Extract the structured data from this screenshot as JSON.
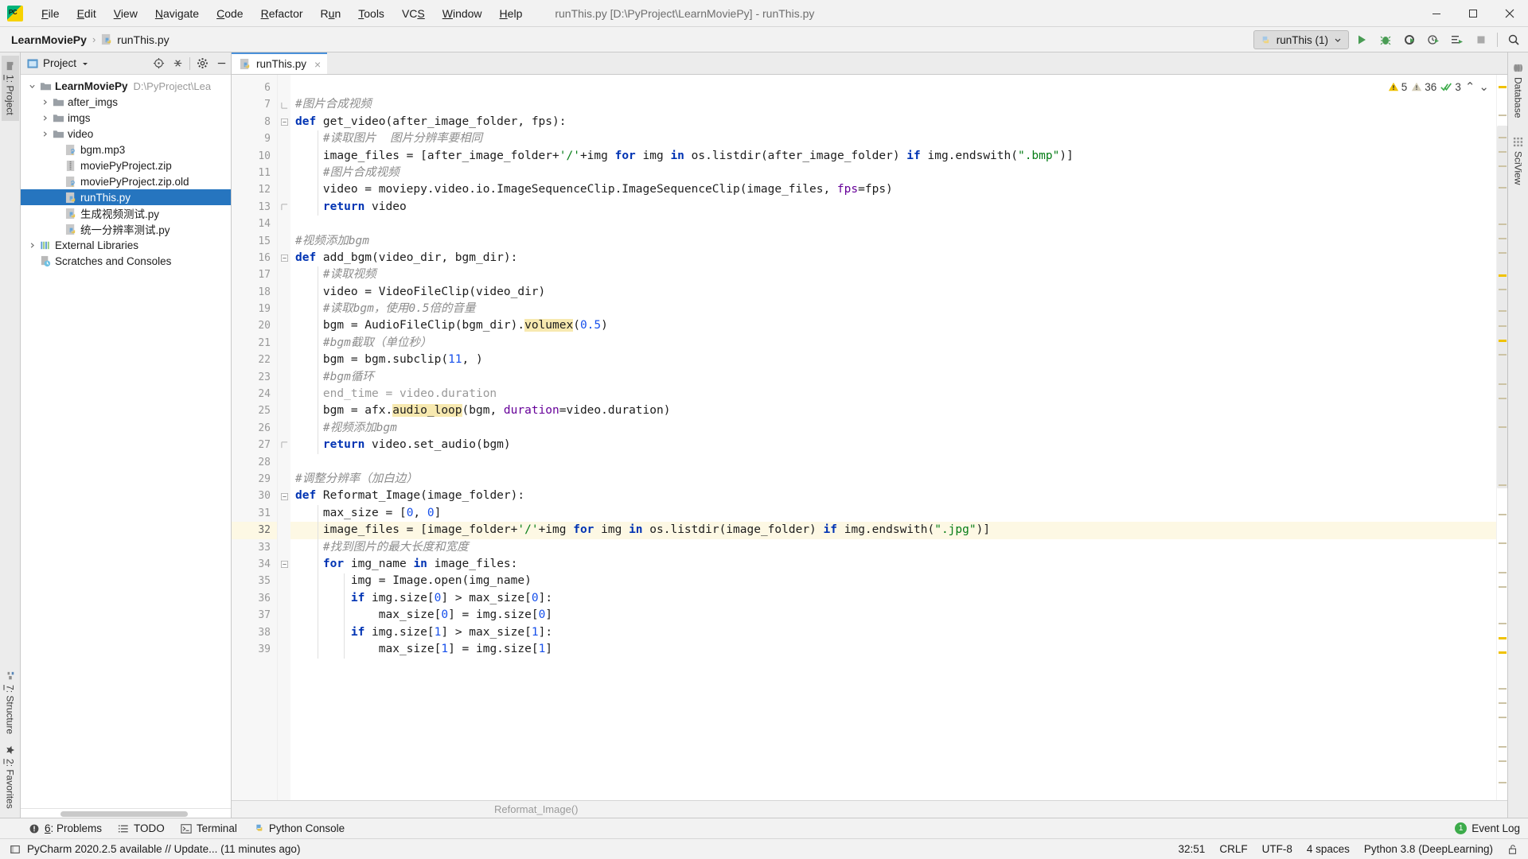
{
  "window": {
    "title": "runThis.py [D:\\PyProject\\LearnMoviePy] - runThis.py",
    "logo": "pycharm-logo"
  },
  "menubar": {
    "items": [
      {
        "pre": "",
        "mn": "F",
        "post": "ile"
      },
      {
        "pre": "",
        "mn": "E",
        "post": "dit"
      },
      {
        "pre": "",
        "mn": "V",
        "post": "iew"
      },
      {
        "pre": "",
        "mn": "N",
        "post": "avigate"
      },
      {
        "pre": "",
        "mn": "C",
        "post": "ode"
      },
      {
        "pre": "",
        "mn": "R",
        "post": "efactor"
      },
      {
        "pre": "R",
        "mn": "u",
        "post": "n"
      },
      {
        "pre": "",
        "mn": "T",
        "post": "ools"
      },
      {
        "pre": "VC",
        "mn": "S",
        "post": ""
      },
      {
        "pre": "",
        "mn": "W",
        "post": "indow"
      },
      {
        "pre": "",
        "mn": "H",
        "post": "elp"
      }
    ]
  },
  "navbar": {
    "project_name": "LearnMoviePy",
    "separator": "›",
    "file_name": "runThis.py",
    "run_config": "runThis (1)",
    "buttons": [
      "run-button",
      "debug-button",
      "run-coverage-button",
      "profile-button",
      "run-with-console-button",
      "stop-button",
      "search-everywhere-button"
    ]
  },
  "left_strip": {
    "top": {
      "num": "1",
      "label": ": Project",
      "icon": "folder-icon"
    },
    "bottom": [
      {
        "num": "7",
        "label": ": Structure",
        "icon": "structure-icon"
      },
      {
        "num": "2",
        "label": ": Favorites",
        "icon": "star-icon"
      }
    ]
  },
  "project_panel": {
    "title": "Project",
    "header_buttons": [
      "locate-icon",
      "collapse-all-icon",
      "settings-gear-icon",
      "hide-icon"
    ],
    "tree": [
      {
        "indent": 0,
        "arrow": "down",
        "icon": "folder-icon",
        "label": "LearnMoviePy",
        "bold": true,
        "path": "D:\\PyProject\\Lea",
        "selected": false
      },
      {
        "indent": 1,
        "arrow": "right",
        "icon": "folder-icon",
        "label": "after_imgs",
        "bold": false,
        "path": "",
        "selected": false
      },
      {
        "indent": 1,
        "arrow": "right",
        "icon": "folder-icon",
        "label": "imgs",
        "bold": false,
        "path": "",
        "selected": false
      },
      {
        "indent": 1,
        "arrow": "right",
        "icon": "folder-icon",
        "label": "video",
        "bold": false,
        "path": "",
        "selected": false
      },
      {
        "indent": 2,
        "arrow": "none",
        "icon": "unknown-file-icon",
        "label": "bgm.mp3",
        "bold": false,
        "path": "",
        "selected": false
      },
      {
        "indent": 2,
        "arrow": "none",
        "icon": "zip-file-icon",
        "label": "moviePyProject.zip",
        "bold": false,
        "path": "",
        "selected": false
      },
      {
        "indent": 2,
        "arrow": "none",
        "icon": "unknown-file-icon",
        "label": "moviePyProject.zip.old",
        "bold": false,
        "path": "",
        "selected": false
      },
      {
        "indent": 2,
        "arrow": "none",
        "icon": "python-file-icon",
        "label": "runThis.py",
        "bold": false,
        "path": "",
        "selected": true
      },
      {
        "indent": 2,
        "arrow": "none",
        "icon": "python-file-icon",
        "label": "生成视频测试.py",
        "bold": false,
        "path": "",
        "selected": false
      },
      {
        "indent": 2,
        "arrow": "none",
        "icon": "python-file-icon",
        "label": "统一分辨率测试.py",
        "bold": false,
        "path": "",
        "selected": false
      },
      {
        "indent": 0,
        "arrow": "right",
        "icon": "library-icon",
        "label": "External Libraries",
        "bold": false,
        "path": "",
        "selected": false
      },
      {
        "indent": 0,
        "arrow": "none",
        "icon": "scratches-icon",
        "label": "Scratches and Consoles",
        "bold": false,
        "path": "",
        "selected": false
      }
    ]
  },
  "editor": {
    "tab": {
      "label": "runThis.py",
      "icon": "python-file-icon",
      "close": "×"
    },
    "inspection": {
      "warning_count": "5",
      "weak_warning_count": "36",
      "ok_count": "3",
      "up": "⌃",
      "down": "⌄"
    },
    "breadcrumb": "Reformat_Image()",
    "first_line": 6,
    "current_line": 32,
    "lines": [
      {
        "n": 6,
        "fold": "",
        "tokens": []
      },
      {
        "n": 7,
        "fold": "end-top",
        "tokens": [
          {
            "t": "#图片合成视频",
            "c": "cm"
          }
        ]
      },
      {
        "n": 8,
        "fold": "start",
        "tokens": [
          {
            "t": "def",
            "c": "k"
          },
          {
            "t": " get_video(after_image_folder, fps):",
            "c": "pl"
          }
        ]
      },
      {
        "n": 9,
        "fold": "",
        "tokens": [
          {
            "t": "    #读取图片  图片分辨率要相同",
            "c": "cm"
          }
        ]
      },
      {
        "n": 10,
        "fold": "",
        "tokens": [
          {
            "t": "    image_files = [after_image_folder+",
            "c": "pl"
          },
          {
            "t": "'/'",
            "c": "s"
          },
          {
            "t": "+img ",
            "c": "pl"
          },
          {
            "t": "for",
            "c": "k"
          },
          {
            "t": " img ",
            "c": "pl"
          },
          {
            "t": "in",
            "c": "k"
          },
          {
            "t": " os.listdir(after_image_folder) ",
            "c": "pl"
          },
          {
            "t": "if",
            "c": "k"
          },
          {
            "t": " img.endswith(",
            "c": "pl"
          },
          {
            "t": "\".bmp\"",
            "c": "s"
          },
          {
            "t": ")]",
            "c": "pl"
          }
        ]
      },
      {
        "n": 11,
        "fold": "",
        "tokens": [
          {
            "t": "    #图片合成视频",
            "c": "cm"
          }
        ]
      },
      {
        "n": 12,
        "fold": "",
        "tokens": [
          {
            "t": "    video = moviepy.video.io.ImageSequenceClip.ImageSequenceClip(image_files, ",
            "c": "pl"
          },
          {
            "t": "fps",
            "c": "kw"
          },
          {
            "t": "=fps)",
            "c": "pl"
          }
        ]
      },
      {
        "n": 13,
        "fold": "end",
        "tokens": [
          {
            "t": "    ",
            "c": "pl"
          },
          {
            "t": "return",
            "c": "k"
          },
          {
            "t": " video",
            "c": "pl"
          }
        ]
      },
      {
        "n": 14,
        "fold": "",
        "tokens": []
      },
      {
        "n": 15,
        "fold": "",
        "tokens": [
          {
            "t": "#视频添加bgm",
            "c": "cm"
          }
        ]
      },
      {
        "n": 16,
        "fold": "start",
        "tokens": [
          {
            "t": "def",
            "c": "k"
          },
          {
            "t": " add_bgm(video_dir, bgm_dir):",
            "c": "pl"
          }
        ]
      },
      {
        "n": 17,
        "fold": "",
        "tokens": [
          {
            "t": "    #读取视频",
            "c": "cm"
          }
        ]
      },
      {
        "n": 18,
        "fold": "",
        "tokens": [
          {
            "t": "    video = VideoFileClip(video_dir)",
            "c": "pl"
          }
        ]
      },
      {
        "n": 19,
        "fold": "",
        "tokens": [
          {
            "t": "    #读取bgm，使用0.5倍的音量",
            "c": "cm"
          }
        ]
      },
      {
        "n": 20,
        "fold": "",
        "tokens": [
          {
            "t": "    bgm = AudioFileClip(bgm_dir).",
            "c": "pl"
          },
          {
            "t": "volumex",
            "c": "hi"
          },
          {
            "t": "(",
            "c": "pl"
          },
          {
            "t": "0.5",
            "c": "n"
          },
          {
            "t": ")",
            "c": "pl"
          }
        ]
      },
      {
        "n": 21,
        "fold": "",
        "tokens": [
          {
            "t": "    #bgm截取（单位秒）",
            "c": "cm"
          }
        ]
      },
      {
        "n": 22,
        "fold": "",
        "tokens": [
          {
            "t": "    bgm = bgm.subclip(",
            "c": "pl"
          },
          {
            "t": "11",
            "c": "n"
          },
          {
            "t": ", )",
            "c": "pl"
          }
        ]
      },
      {
        "n": 23,
        "fold": "",
        "tokens": [
          {
            "t": "    #bgm循环",
            "c": "cm"
          }
        ]
      },
      {
        "n": 24,
        "fold": "",
        "tokens": [
          {
            "t": "    end_time = video.duration",
            "c": "dim"
          }
        ]
      },
      {
        "n": 25,
        "fold": "",
        "tokens": [
          {
            "t": "    bgm = afx.",
            "c": "pl"
          },
          {
            "t": "audio_loop",
            "c": "hi"
          },
          {
            "t": "(bgm, ",
            "c": "pl"
          },
          {
            "t": "duration",
            "c": "kw"
          },
          {
            "t": "=video.duration)",
            "c": "pl"
          }
        ]
      },
      {
        "n": 26,
        "fold": "",
        "tokens": [
          {
            "t": "    #视频添加bgm",
            "c": "cm"
          }
        ]
      },
      {
        "n": 27,
        "fold": "end",
        "tokens": [
          {
            "t": "    ",
            "c": "pl"
          },
          {
            "t": "return",
            "c": "k"
          },
          {
            "t": " video.set_audio(bgm)",
            "c": "pl"
          }
        ]
      },
      {
        "n": 28,
        "fold": "",
        "tokens": []
      },
      {
        "n": 29,
        "fold": "",
        "tokens": [
          {
            "t": "#调整分辨率（加白边）",
            "c": "cm"
          }
        ]
      },
      {
        "n": 30,
        "fold": "start",
        "tokens": [
          {
            "t": "def",
            "c": "k"
          },
          {
            "t": " Reformat_Image(image_folder):",
            "c": "pl"
          }
        ]
      },
      {
        "n": 31,
        "fold": "",
        "tokens": [
          {
            "t": "    max_size = [",
            "c": "pl"
          },
          {
            "t": "0",
            "c": "n"
          },
          {
            "t": ", ",
            "c": "pl"
          },
          {
            "t": "0",
            "c": "n"
          },
          {
            "t": "]",
            "c": "pl"
          }
        ]
      },
      {
        "n": 32,
        "fold": "",
        "tokens": [
          {
            "t": "    image_files = [image_folder+",
            "c": "pl"
          },
          {
            "t": "'/'",
            "c": "s"
          },
          {
            "t": "+img ",
            "c": "pl"
          },
          {
            "t": "for",
            "c": "k"
          },
          {
            "t": " img ",
            "c": "pl"
          },
          {
            "t": "in",
            "c": "k"
          },
          {
            "t": " os.listdir(image_folder) ",
            "c": "pl"
          },
          {
            "t": "if",
            "c": "k"
          },
          {
            "t": " img.endswith(",
            "c": "pl"
          },
          {
            "t": "\".jpg\"",
            "c": "s"
          },
          {
            "t": ")]",
            "c": "pl"
          }
        ]
      },
      {
        "n": 33,
        "fold": "",
        "tokens": [
          {
            "t": "    #找到图片的最大长度和宽度",
            "c": "cm"
          }
        ]
      },
      {
        "n": 34,
        "fold": "start",
        "tokens": [
          {
            "t": "    ",
            "c": "pl"
          },
          {
            "t": "for",
            "c": "k"
          },
          {
            "t": " img_name ",
            "c": "pl"
          },
          {
            "t": "in",
            "c": "k"
          },
          {
            "t": " image_files:",
            "c": "pl"
          }
        ]
      },
      {
        "n": 35,
        "fold": "",
        "tokens": [
          {
            "t": "        img = Image.open(img_name)",
            "c": "pl"
          }
        ]
      },
      {
        "n": 36,
        "fold": "",
        "tokens": [
          {
            "t": "        ",
            "c": "pl"
          },
          {
            "t": "if",
            "c": "k"
          },
          {
            "t": " img.size[",
            "c": "pl"
          },
          {
            "t": "0",
            "c": "n"
          },
          {
            "t": "] > max_size[",
            "c": "pl"
          },
          {
            "t": "0",
            "c": "n"
          },
          {
            "t": "]:",
            "c": "pl"
          }
        ]
      },
      {
        "n": 37,
        "fold": "",
        "tokens": [
          {
            "t": "            max_size[",
            "c": "pl"
          },
          {
            "t": "0",
            "c": "n"
          },
          {
            "t": "] = img.size[",
            "c": "pl"
          },
          {
            "t": "0",
            "c": "n"
          },
          {
            "t": "]",
            "c": "pl"
          }
        ]
      },
      {
        "n": 38,
        "fold": "",
        "tokens": [
          {
            "t": "        ",
            "c": "pl"
          },
          {
            "t": "if",
            "c": "k"
          },
          {
            "t": " img.size[",
            "c": "pl"
          },
          {
            "t": "1",
            "c": "n"
          },
          {
            "t": "] > max_size[",
            "c": "pl"
          },
          {
            "t": "1",
            "c": "n"
          },
          {
            "t": "]:",
            "c": "pl"
          }
        ]
      },
      {
        "n": 39,
        "fold": "",
        "tokens": [
          {
            "t": "            max_size[",
            "c": "pl"
          },
          {
            "t": "1",
            "c": "n"
          },
          {
            "t": "] = img.size[",
            "c": "pl"
          },
          {
            "t": "1",
            "c": "n"
          },
          {
            "t": "]",
            "c": "pl"
          }
        ]
      }
    ]
  },
  "right_strip": [
    {
      "label": "Database",
      "icon": "database-icon"
    },
    {
      "label": "SciView",
      "icon": "sciview-icon"
    }
  ],
  "toolwindows": {
    "items": [
      {
        "icon": "problems-icon",
        "num": "6",
        "label": ": Problems"
      },
      {
        "icon": "todo-icon",
        "num": "",
        "label": "TODO"
      },
      {
        "icon": "terminal-icon",
        "num": "",
        "label": "Terminal"
      },
      {
        "icon": "python-console-icon",
        "num": "",
        "label": "Python Console"
      }
    ],
    "event_log": {
      "count": "1",
      "label": "Event Log"
    }
  },
  "statusbar": {
    "message": "PyCharm 2020.2.5 available // Update... (11 minutes ago)",
    "caret": "32:51",
    "line_separator": "CRLF",
    "encoding": "UTF-8",
    "indent": "4 spaces",
    "interpreter": "Python 3.8 (DeepLearning)",
    "lock_icon": "unlocked-icon"
  },
  "colors": {
    "accent_blue": "#2675bf",
    "keyword_blue": "#0033b3",
    "string_green": "#067d17",
    "number_blue": "#1750eb",
    "comment_gray": "#8c8c8c",
    "highlight_yellow": "#f7e9b0",
    "current_line": "#fdf8e4",
    "warning_yellow": "#f0c200",
    "green_run": "#3cab4a"
  },
  "markers": [
    {
      "top": 0.015,
      "cls": "warn"
    },
    {
      "top": 0.055,
      "cls": "weak"
    },
    {
      "top": 0.085,
      "cls": "weak"
    },
    {
      "top": 0.105,
      "cls": "weak"
    },
    {
      "top": 0.125,
      "cls": "weak"
    },
    {
      "top": 0.155,
      "cls": "weak"
    },
    {
      "top": 0.205,
      "cls": "weak"
    },
    {
      "top": 0.225,
      "cls": "weak"
    },
    {
      "top": 0.245,
      "cls": "weak"
    },
    {
      "top": 0.275,
      "cls": "warn"
    },
    {
      "top": 0.295,
      "cls": "weak"
    },
    {
      "top": 0.325,
      "cls": "weak"
    },
    {
      "top": 0.345,
      "cls": "weak"
    },
    {
      "top": 0.365,
      "cls": "warn"
    },
    {
      "top": 0.385,
      "cls": "weak"
    },
    {
      "top": 0.425,
      "cls": "weak"
    },
    {
      "top": 0.445,
      "cls": "weak"
    },
    {
      "top": 0.485,
      "cls": "weak"
    },
    {
      "top": 0.565,
      "cls": "weak"
    },
    {
      "top": 0.605,
      "cls": "weak"
    },
    {
      "top": 0.645,
      "cls": "weak"
    },
    {
      "top": 0.685,
      "cls": "weak"
    },
    {
      "top": 0.705,
      "cls": "weak"
    },
    {
      "top": 0.755,
      "cls": "weak"
    },
    {
      "top": 0.775,
      "cls": "warn"
    },
    {
      "top": 0.795,
      "cls": "warn"
    },
    {
      "top": 0.845,
      "cls": "weak"
    },
    {
      "top": 0.865,
      "cls": "weak"
    },
    {
      "top": 0.885,
      "cls": "weak"
    },
    {
      "top": 0.925,
      "cls": "weak"
    },
    {
      "top": 0.945,
      "cls": "weak"
    },
    {
      "top": 0.975,
      "cls": "weak"
    }
  ]
}
